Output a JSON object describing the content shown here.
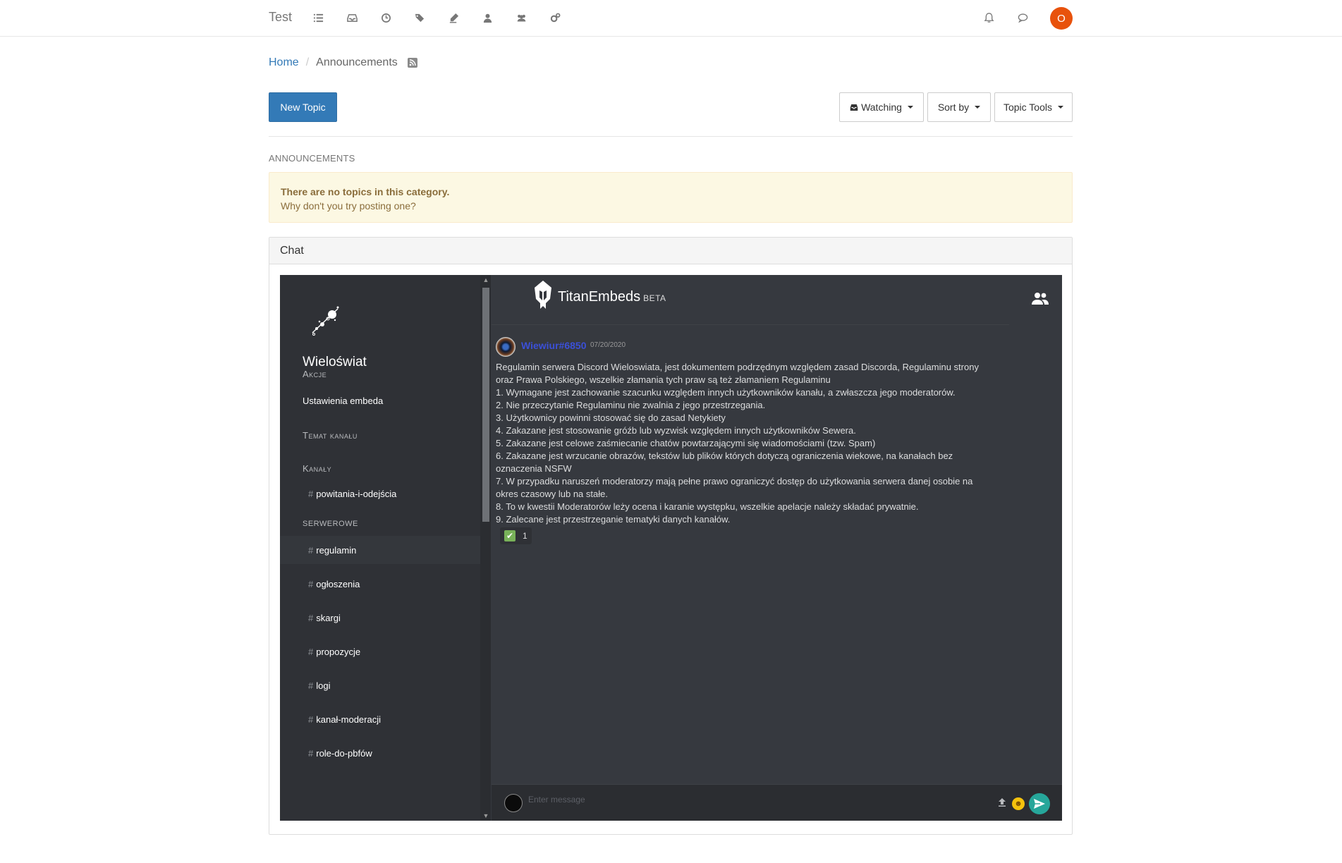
{
  "navbar": {
    "brand": "Test",
    "avatar_letter": "O",
    "avatar_color": "#e8520c",
    "icons": [
      "list-icon",
      "inbox-icon",
      "clock-icon",
      "tags-icon",
      "pencil-icon",
      "user-icon",
      "users-icon",
      "gears-icon",
      "bell-icon",
      "chat-icon"
    ]
  },
  "breadcrumb": {
    "home": "Home",
    "current": "Announcements"
  },
  "actions": {
    "new_topic": "New Topic",
    "watching": "Watching",
    "sort_by": "Sort by",
    "topic_tools": "Topic Tools"
  },
  "section_label": "ANNOUNCEMENTS",
  "alert": {
    "title": "There are no topics in this category.",
    "text": "Why don't you try posting one?"
  },
  "chat_panel": {
    "heading": "Chat"
  },
  "embed": {
    "server_name": "Wieloświat",
    "sidebar": {
      "actions_heading": "Akcje",
      "embed_settings": "Ustawienia embeda",
      "channel_topic_heading": "Temat kanału",
      "channels_heading": "Kanały",
      "first_channel": "powitania-i-odejścia",
      "category": "SERWEROWE",
      "channels": [
        "regulamin",
        "ogłoszenia",
        "skargi",
        "propozycje",
        "logi",
        "kanał-moderacji",
        "role-do-pbfów"
      ]
    },
    "brand_name": "TitanEmbeds",
    "brand_tag": "BETA",
    "message": {
      "user": "Wiewiur#6850",
      "timestamp": "07/20/2020",
      "lines": [
        "Regulamin serwera Discord Wieloswiata, jest dokumentem podrzędnym względem zasad Discorda, Regulaminu strony",
        "oraz Prawa Polskiego, wszelkie złamania tych praw są też złamaniem Regulaminu",
        "1. Wymagane jest zachowanie szacunku względem innych użytkowników kanału, a zwłaszcza jego moderatorów.",
        "2. Nie przeczytanie Regulaminu nie zwalnia z jego przestrzegania.",
        "3. Użytkownicy powinni stosować się do zasad Netykiety",
        "4. Zakazane jest stosowanie gróźb lub wyzwisk względem innych użytkowników Sewera.",
        "5. Zakazane jest celowe zaśmiecanie chatów powtarzającymi się wiadomościami (tzw. Spam)",
        "6. Zakazane jest wrzucanie obrazów, tekstów lub plików których dotyczą ograniczenia wiekowe, na kanałach bez",
        "oznaczenia NSFW",
        "7. W przypadku naruszeń moderatorzy mają pełne prawo ograniczyć dostęp do użytkowania serwera danej osobie na",
        "okres czasowy lub na stałe.",
        "8. To w kwestii Moderatorów leży ocena i karanie występku, wszelkie apelacje należy składać prywatnie.",
        "9. Zalecane jest przestrzeganie tematyki danych kanałów."
      ],
      "reaction_count": "1"
    },
    "composer_placeholder": "Enter message"
  }
}
